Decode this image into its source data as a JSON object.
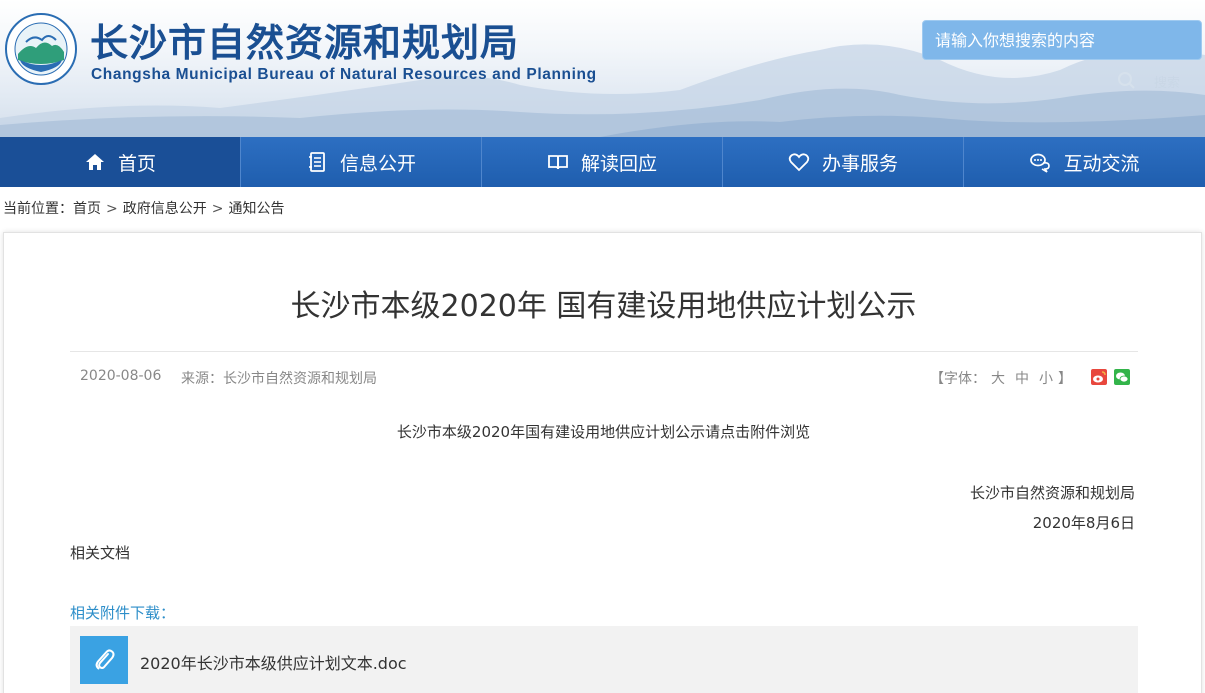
{
  "header": {
    "title": "长沙市自然资源和规划局",
    "subtitle": "Changsha Municipal Bureau of Natural Resources and Planning",
    "search_placeholder": "请输入你想搜索的内容",
    "search_button": "搜索"
  },
  "nav": {
    "items": [
      {
        "label": "首页",
        "icon": "home-icon"
      },
      {
        "label": "信息公开",
        "icon": "document-list-icon"
      },
      {
        "label": "解读回应",
        "icon": "open-book-icon"
      },
      {
        "label": "办事服务",
        "icon": "heart-icon"
      },
      {
        "label": "互动交流",
        "icon": "chat-bubbles-icon"
      }
    ]
  },
  "breadcrumb": {
    "prefix": "当前位置：",
    "items": [
      "首页",
      "政府信息公开",
      "通知公告"
    ],
    "separator": ">"
  },
  "article": {
    "title": "长沙市本级2020年 国有建设用地供应计划公示",
    "date": "2020-08-06",
    "source": "来源：长沙市自然资源和规划局",
    "font_size": {
      "open": "【字体：",
      "large": "大",
      "medium": "中",
      "small": "小",
      "close": "】"
    },
    "body": "长沙市本级2020年国有建设用地供应计划公示请点击附件浏览",
    "signature_org": "长沙市自然资源和规划局",
    "signature_date": "2020年8月6日",
    "related_docs": "相关文档",
    "attachments_title": "相关附件下载：",
    "attachments": [
      {
        "name": "2020年长沙市本级供应计划文本.doc",
        "icon": "paperclip-icon"
      }
    ]
  },
  "colors": {
    "brand_blue": "#1a4f92",
    "nav_blue": "#2d6fc2",
    "attach_blue": "#3aa2e3",
    "link_blue": "#2d8ec9"
  }
}
